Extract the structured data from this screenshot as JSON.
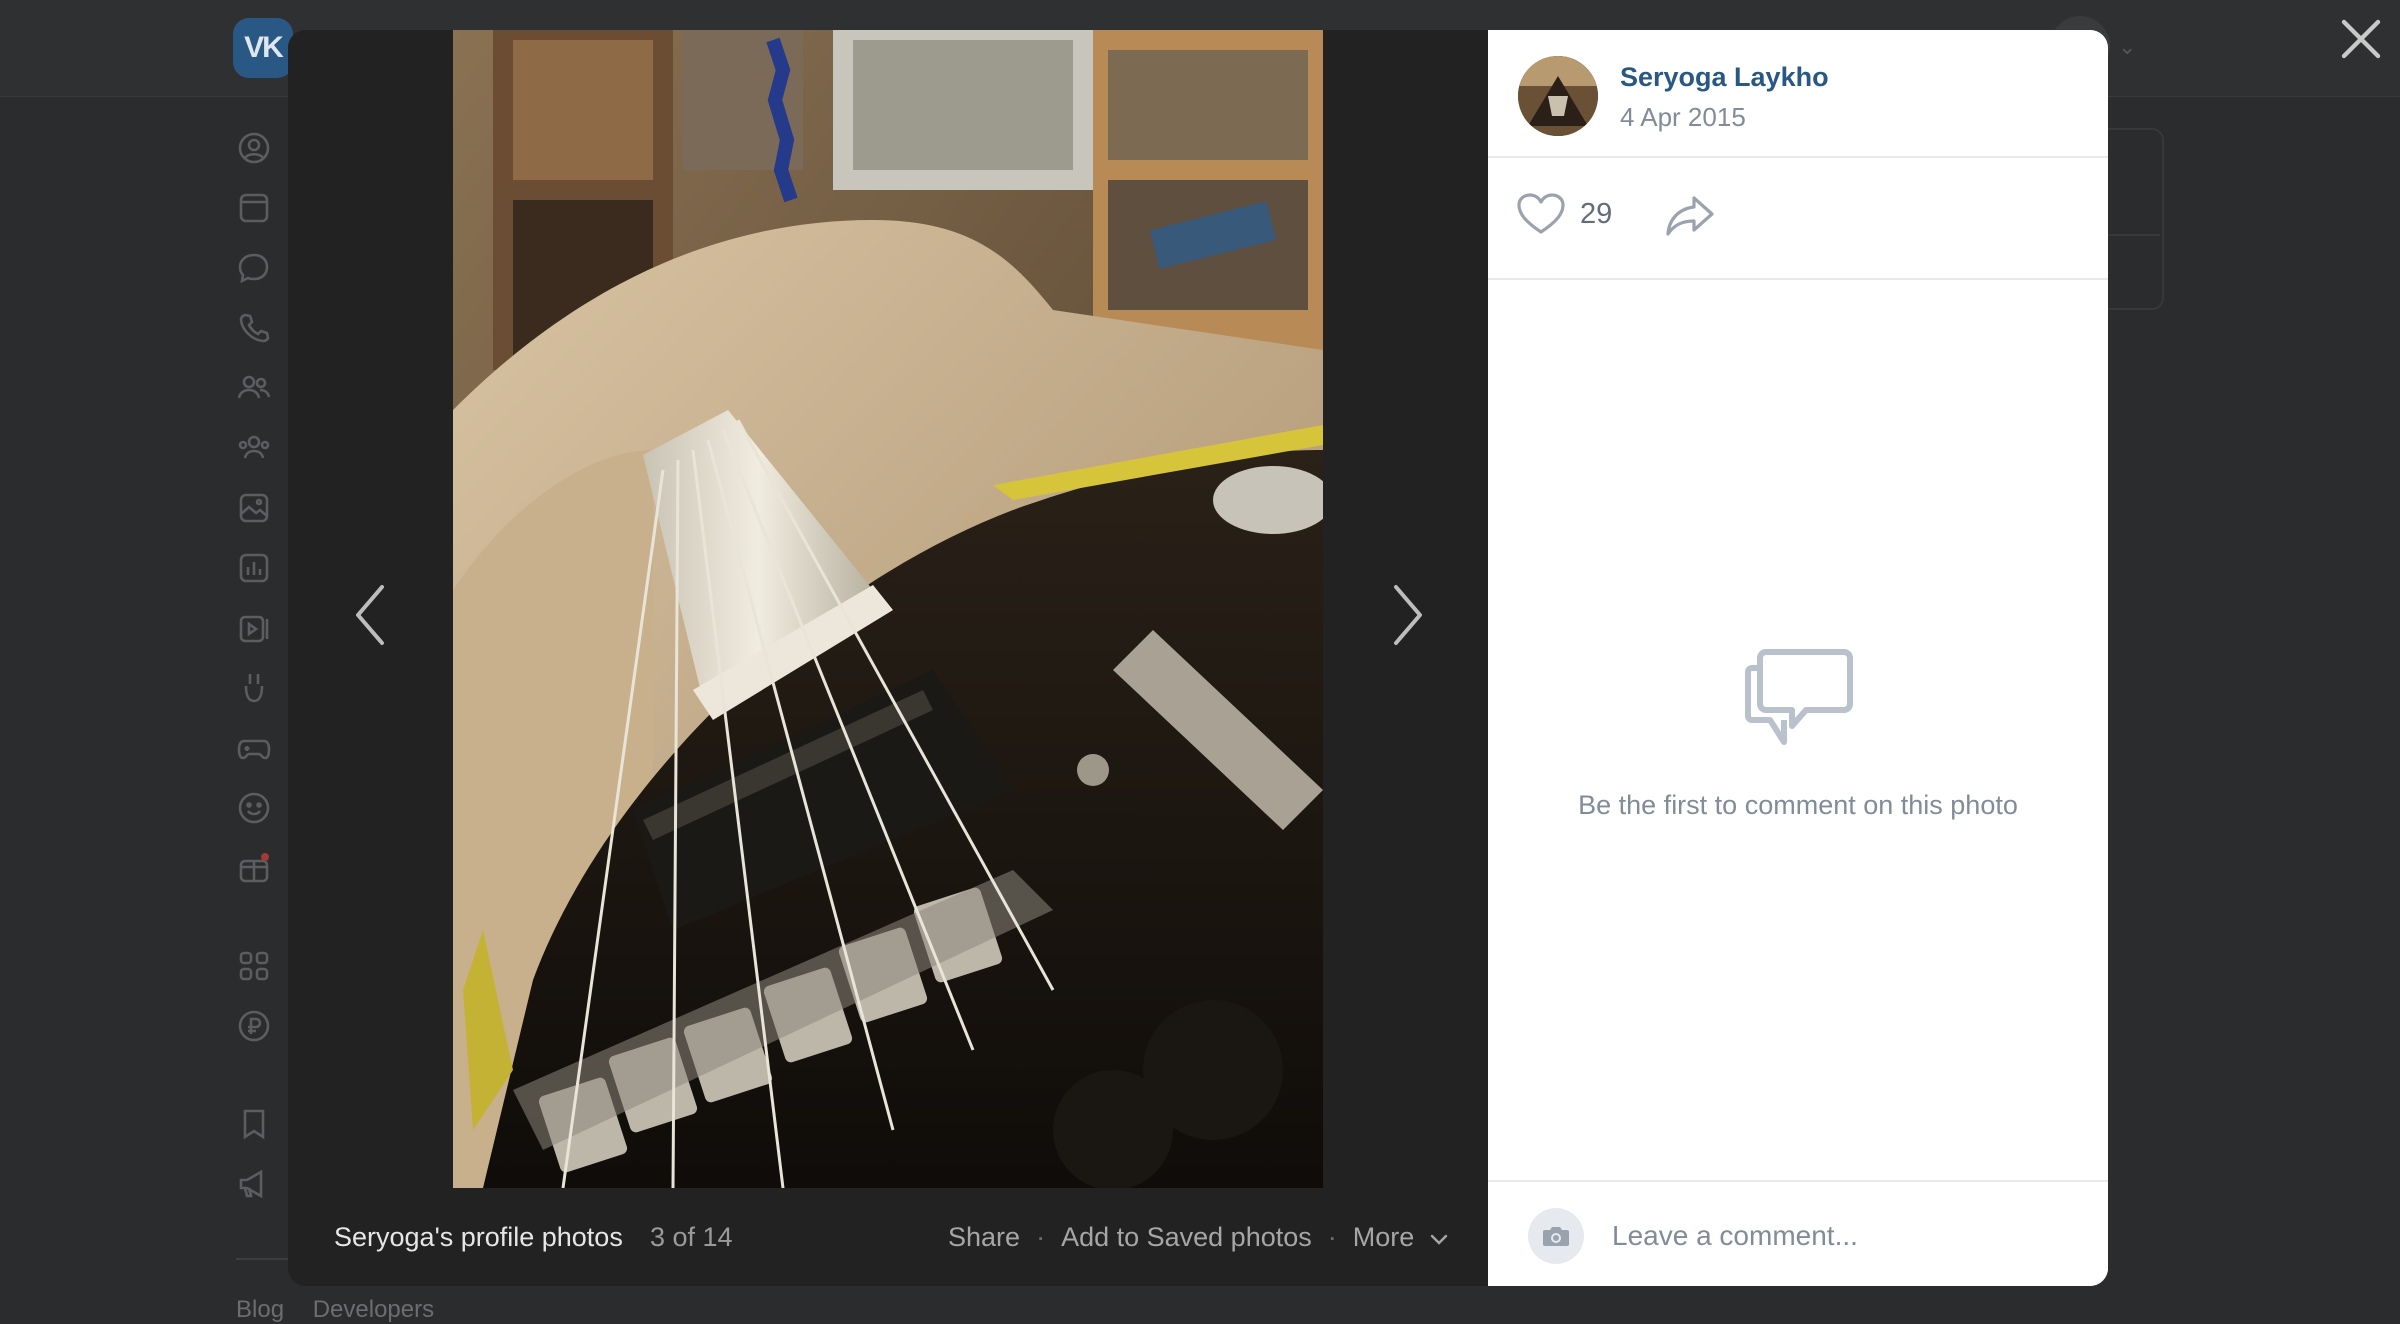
{
  "app": {
    "logo_text": "VK"
  },
  "background": {
    "footer_links": [
      "Blog",
      "Developers"
    ]
  },
  "viewer": {
    "album_title": "Seryoga's profile photos",
    "counter": "3 of 14",
    "actions": {
      "share": "Share",
      "save": "Add to Saved photos",
      "more": "More"
    },
    "author": {
      "name": "Seryoga Laykho",
      "date": "4 Apr 2015"
    },
    "likes": "29",
    "empty_comments_text": "Be the first to comment on this photo",
    "comment_placeholder": "Leave a comment..."
  },
  "colors": {
    "link": "#2a5885",
    "muted": "#818c99",
    "overlay": "#2b2c2e"
  },
  "icons": {
    "nav": [
      "profile-icon",
      "news-icon",
      "messenger-icon",
      "calls-icon",
      "friends-icon",
      "communities-icon",
      "photos-icon",
      "music-icon",
      "videos-icon",
      "clips-icon",
      "games-icon",
      "stickers-icon",
      "gifts-icon",
      "services-icon",
      "vk-pay-icon",
      "bookmarks-icon",
      "ads-icon"
    ]
  }
}
